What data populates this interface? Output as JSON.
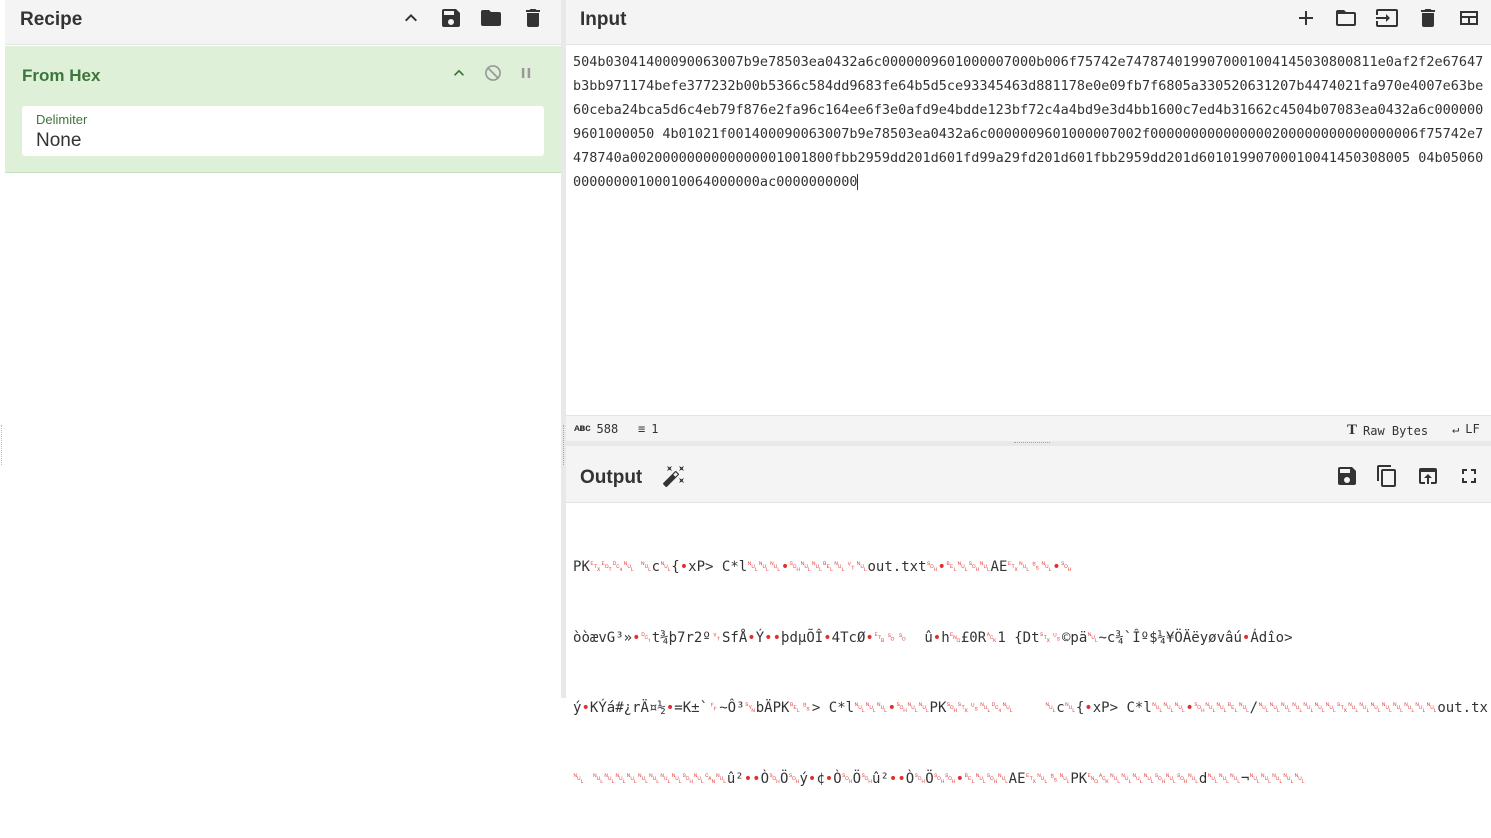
{
  "recipe": {
    "title": "Recipe",
    "icons": [
      "chevron-up-icon",
      "save-icon",
      "folder-icon",
      "trash-icon"
    ],
    "operation": {
      "name": "From Hex",
      "controls": [
        "chevron-up-icon",
        "disable-icon",
        "pause-icon"
      ],
      "argument": {
        "label": "Delimiter",
        "value": "None"
      }
    }
  },
  "input": {
    "title": "Input",
    "icons": [
      "plus-icon",
      "folder-icon",
      "import-icon",
      "trash-icon",
      "layout-icon"
    ],
    "text": "504b03041400090063007b9e78503ea0432a6c0000009601000007000b006f75742e7478740199070001004145030800811e0af2f2e67647b3bb971174befe377232b00b5366c584dd9683fe64b5d5ce93345463d881178e0e09fb7f6805a330520631207b4474021fa970e4007e63be60ceba24bca5d6c4eb79f876e2fa96c164ee6f3e0afd9e4bdde123bf72c4a4bd9e3d4bb1600c7ed4b31662c4504b07083ea0432a6c0000009601000050 4b01021f001400090063007b9e78503ea0432a6c0000009601000007002f000000000000000200000000000000006f75742e7478740a0020000000000000001001800fbb2959dd201d601fd99a29fd201d601fbb2959dd201d60101990700010041450308005 04b0506000000000100010064000000ac0000000000",
    "status": {
      "length_label": "588",
      "lines_label": "1",
      "encoding_label": "Raw Bytes",
      "eol_label": "LF"
    }
  },
  "output": {
    "title": "Output",
    "icons": [
      "magic-wand-icon",
      "save-icon",
      "copy-icon",
      "replace-input-icon",
      "maximize-icon"
    ],
    "lines": [
      "PK␃␄␔␀\t␀c␀{•xP> C*l␀␀␀•␁␀␀␇␀␋␀out.txt␁•␇␀␁␀AE␃␀␈␀•␁",
      "òòævG³»•␑t¾þ7r2º␋SfÅ•Ý••þdµÕÎ•4TcØ•␗␎␎  û•h␅£0R␆1 {Dt␂␟©pä␀~c¾`Îº$¼¥ÖÄëyøvâú•Ádîo>",
      "ý•KÝá#¿rÄ¤½•=K±`␌~Ô³␖bÄPK␇␈> C*l␀␀␀•␁␀␀PK␁␂␟␀␔␀\t␀c␀{•xP> C*l␀␀␀•␁␀␀␇␀/␀␀␀␀␀␀␀␂␀␀␀␀␀␀␀␀out.txt",
      "␀ ␀␀␀␀␀␀␀␀␁␀␘␀û²••Ò␁Ö␁ý•¢•Ò␁Ö␁û²••Ò␁Ö␁␁•␇␀␁␀AE␃␀␈␀PK␅␆␀␀␀␀␁␀␁␀d␀␀␀¬␀␀␀␀␀"
    ]
  }
}
